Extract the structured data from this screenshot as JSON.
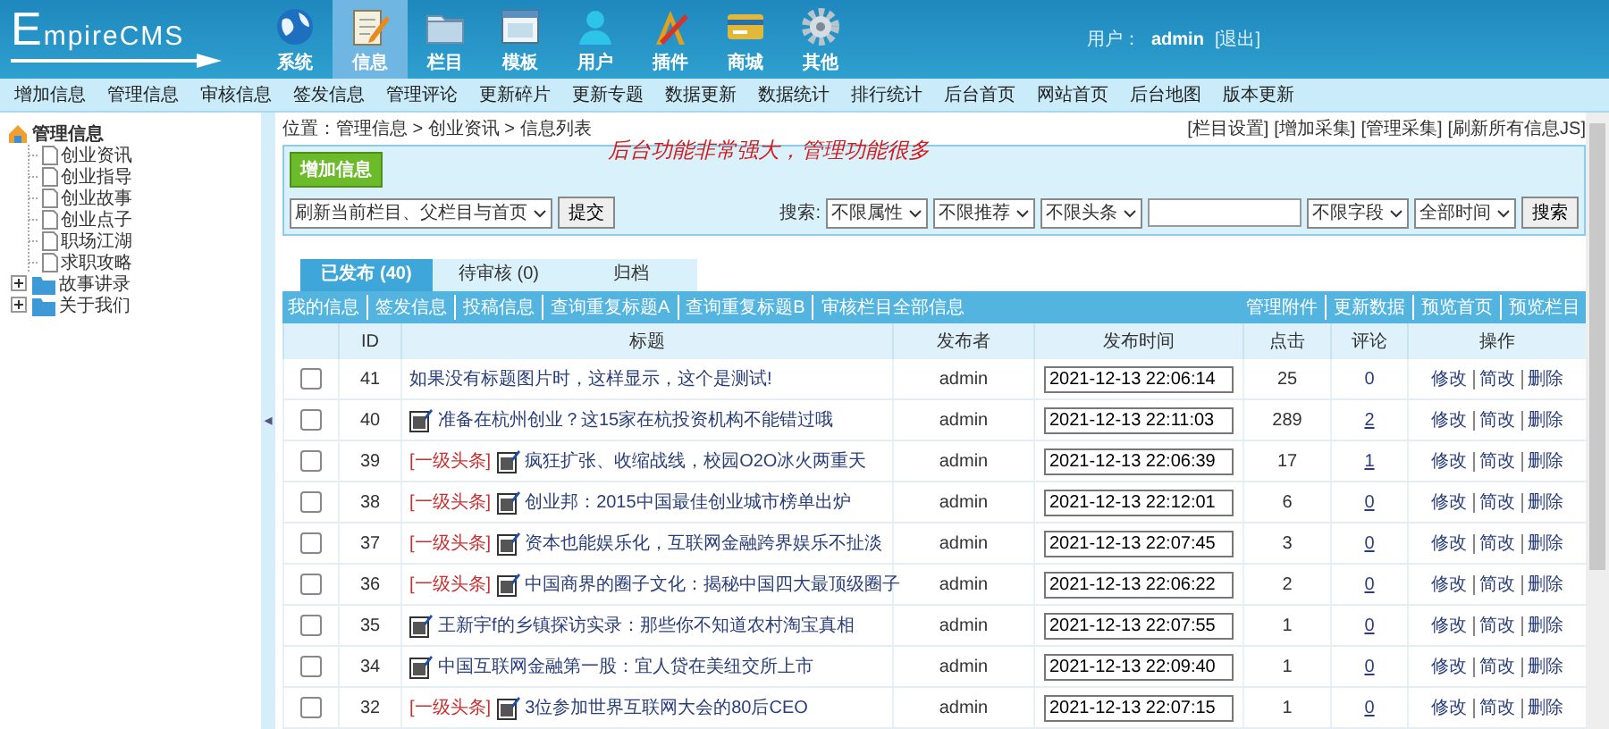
{
  "logo": {
    "text": "EmpireCMS"
  },
  "nav": [
    {
      "label": "系统",
      "kind": "globe",
      "selected": false
    },
    {
      "label": "信息",
      "kind": "notepad",
      "selected": true
    },
    {
      "label": "栏目",
      "kind": "folder",
      "selected": false
    },
    {
      "label": "模板",
      "kind": "window",
      "selected": false
    },
    {
      "label": "用户",
      "kind": "person",
      "selected": false
    },
    {
      "label": "插件",
      "kind": "tools",
      "selected": false
    },
    {
      "label": "商城",
      "kind": "card",
      "selected": false
    },
    {
      "label": "其他",
      "kind": "gear",
      "selected": false
    }
  ],
  "user": {
    "label": "用户：",
    "name": "admin",
    "logout": "[退出]"
  },
  "subnav": [
    "增加信息",
    "管理信息",
    "审核信息",
    "签发信息",
    "管理评论",
    "更新碎片",
    "更新专题",
    "数据更新",
    "数据统计",
    "排行统计",
    "后台首页",
    "网站首页",
    "后台地图",
    "版本更新"
  ],
  "sidebar": {
    "root": "管理信息",
    "items": [
      {
        "label": "创业资讯",
        "kind": "page"
      },
      {
        "label": "创业指导",
        "kind": "page"
      },
      {
        "label": "创业故事",
        "kind": "page"
      },
      {
        "label": "创业点子",
        "kind": "page"
      },
      {
        "label": "职场江湖",
        "kind": "page"
      },
      {
        "label": "求职攻略",
        "kind": "page"
      },
      {
        "label": "故事讲录",
        "kind": "folder",
        "expanded": false
      },
      {
        "label": "关于我们",
        "kind": "folder",
        "expanded": false
      }
    ]
  },
  "collapse_handle": "◂",
  "breadcrumb": "位置：管理信息 > 创业资讯 > 信息列表",
  "top_links": [
    "[栏目设置]",
    "[增加采集]",
    "[管理采集]",
    "[刷新所有信息JS]"
  ],
  "annotation": "后台功能非常强大，管理功能很多",
  "add_button": "增加信息",
  "refresh": {
    "select": "刷新当前栏目、父栏目与首页",
    "button": "提交"
  },
  "search": {
    "label": "搜索:",
    "filters": [
      "不限属性",
      "不限推荐",
      "不限头条"
    ],
    "field_selects": [
      "不限字段",
      "全部时间"
    ],
    "button": "搜索"
  },
  "tabs": [
    {
      "label": "已发布 (40)",
      "selected": true
    },
    {
      "label": "待审核 (0)",
      "selected": false
    },
    {
      "label": "归档",
      "selected": false
    }
  ],
  "link_bar": {
    "left": [
      "我的信息",
      "签发信息",
      "投稿信息",
      "查询重复标题A",
      "查询重复标题B",
      "审核栏目全部信息"
    ],
    "right": [
      "管理附件",
      "更新数据",
      "预览首页",
      "预览栏目"
    ]
  },
  "table": {
    "columns": [
      "ID",
      "标题",
      "发布者",
      "发布时间",
      "点击",
      "评论",
      "操作"
    ],
    "rows": [
      {
        "checked": false,
        "id": "41",
        "tag": null,
        "has_image": false,
        "title": "如果没有标题图片时，这样显示，这个是测试!",
        "author": "admin",
        "time": "2021-12-13 22:06:14",
        "clicks": "25",
        "comments": "0",
        "comment_link": false,
        "actions": [
          "修改",
          "简改",
          "删除"
        ]
      },
      {
        "checked": false,
        "id": "40",
        "tag": null,
        "has_image": true,
        "title": "准备在杭州创业？这15家在杭投资机构不能错过哦",
        "author": "admin",
        "time": "2021-12-13 22:11:03",
        "clicks": "289",
        "comments": "2",
        "comment_link": true,
        "actions": [
          "修改",
          "简改",
          "删除"
        ]
      },
      {
        "checked": false,
        "id": "39",
        "tag": "[一级头条]",
        "has_image": true,
        "title": "疯狂扩张、收缩战线，校园O2O冰火两重天",
        "author": "admin",
        "time": "2021-12-13 22:06:39",
        "clicks": "17",
        "comments": "1",
        "comment_link": true,
        "actions": [
          "修改",
          "简改",
          "删除"
        ]
      },
      {
        "checked": false,
        "id": "38",
        "tag": "[一级头条]",
        "has_image": true,
        "title": "创业邦：2015中国最佳创业城市榜单出炉",
        "author": "admin",
        "time": "2021-12-13 22:12:01",
        "clicks": "6",
        "comments": "0",
        "comment_link": true,
        "actions": [
          "修改",
          "简改",
          "删除"
        ]
      },
      {
        "checked": false,
        "id": "37",
        "tag": "[一级头条]",
        "has_image": true,
        "title": "资本也能娱乐化，互联网金融跨界娱乐不扯淡",
        "author": "admin",
        "time": "2021-12-13 22:07:45",
        "clicks": "3",
        "comments": "0",
        "comment_link": true,
        "actions": [
          "修改",
          "简改",
          "删除"
        ]
      },
      {
        "checked": false,
        "id": "36",
        "tag": "[一级头条]",
        "has_image": true,
        "title": "中国商界的圈子文化：揭秘中国四大最顶级圈子",
        "author": "admin",
        "time": "2021-12-13 22:06:22",
        "clicks": "2",
        "comments": "0",
        "comment_link": true,
        "actions": [
          "修改",
          "简改",
          "删除"
        ]
      },
      {
        "checked": false,
        "id": "35",
        "tag": null,
        "has_image": true,
        "title": "王新宇f的乡镇探访实录：那些你不知道农村淘宝真相",
        "author": "admin",
        "time": "2021-12-13 22:07:55",
        "clicks": "1",
        "comments": "0",
        "comment_link": true,
        "actions": [
          "修改",
          "简改",
          "删除"
        ]
      },
      {
        "checked": false,
        "id": "34",
        "tag": null,
        "has_image": true,
        "title": "中国互联网金融第一股：宜人贷在美纽交所上市",
        "author": "admin",
        "time": "2021-12-13 22:09:40",
        "clicks": "1",
        "comments": "0",
        "comment_link": true,
        "actions": [
          "修改",
          "简改",
          "删除"
        ]
      },
      {
        "checked": false,
        "id": "32",
        "tag": "[一级头条]",
        "has_image": true,
        "title": "3位参加世界互联网大会的80后CEO",
        "author": "admin",
        "time": "2021-12-13 22:07:15",
        "clicks": "1",
        "comments": "0",
        "comment_link": true,
        "actions": [
          "修改",
          "简改",
          "删除"
        ]
      }
    ]
  }
}
